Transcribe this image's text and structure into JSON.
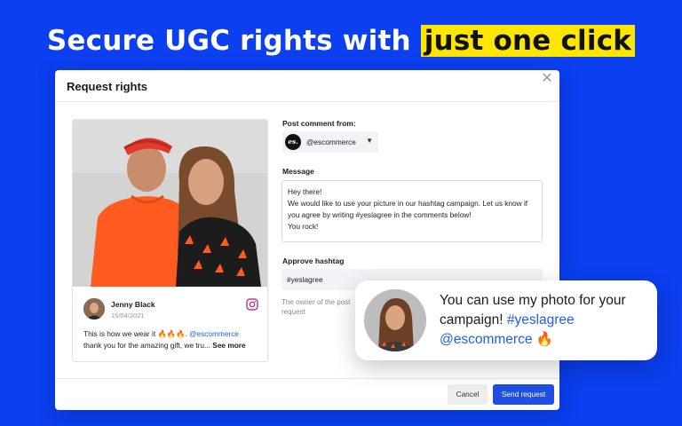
{
  "headline": {
    "prefix": "Secure UGC rights with ",
    "highlight": "just one click"
  },
  "modal": {
    "title": "Request rights",
    "close_symbol": "✕"
  },
  "post": {
    "author": "Jenny Black",
    "date": "15/04/2021",
    "platform_icon": "instagram-icon",
    "text_prefix": "This is how we wear it 🔥🔥🔥. ",
    "mention": "@escommerce",
    "text_line2": "thank you for the amazing gift, we tru... ",
    "see_more": "See more"
  },
  "form": {
    "post_from_label": "Post comment from:",
    "account_logo_text": "es.",
    "account_name": "@escommerce",
    "message_label": "Message",
    "message_value": "Hey there!\nWe would like to use your picture in our hashtag campaign. Let us know if you agree by writing #yeslagree in the comments below!\nYou rock!",
    "hashtag_label": "Approve hashtag",
    "hashtag_value": "#yeslagree",
    "hint_text": "The owner of the post request"
  },
  "buttons": {
    "cancel": "Cancel",
    "send": "Send request"
  },
  "bubble": {
    "text_part1": "You can use my photo for your campaign! ",
    "hashtag": "#yeslagree",
    "mention": "@escommerce",
    "emoji": "🔥"
  },
  "colors": {
    "background": "#0b3ff0",
    "highlight": "#ffe600",
    "primary_button": "#1f4fe0",
    "link": "#1f5ee8"
  }
}
